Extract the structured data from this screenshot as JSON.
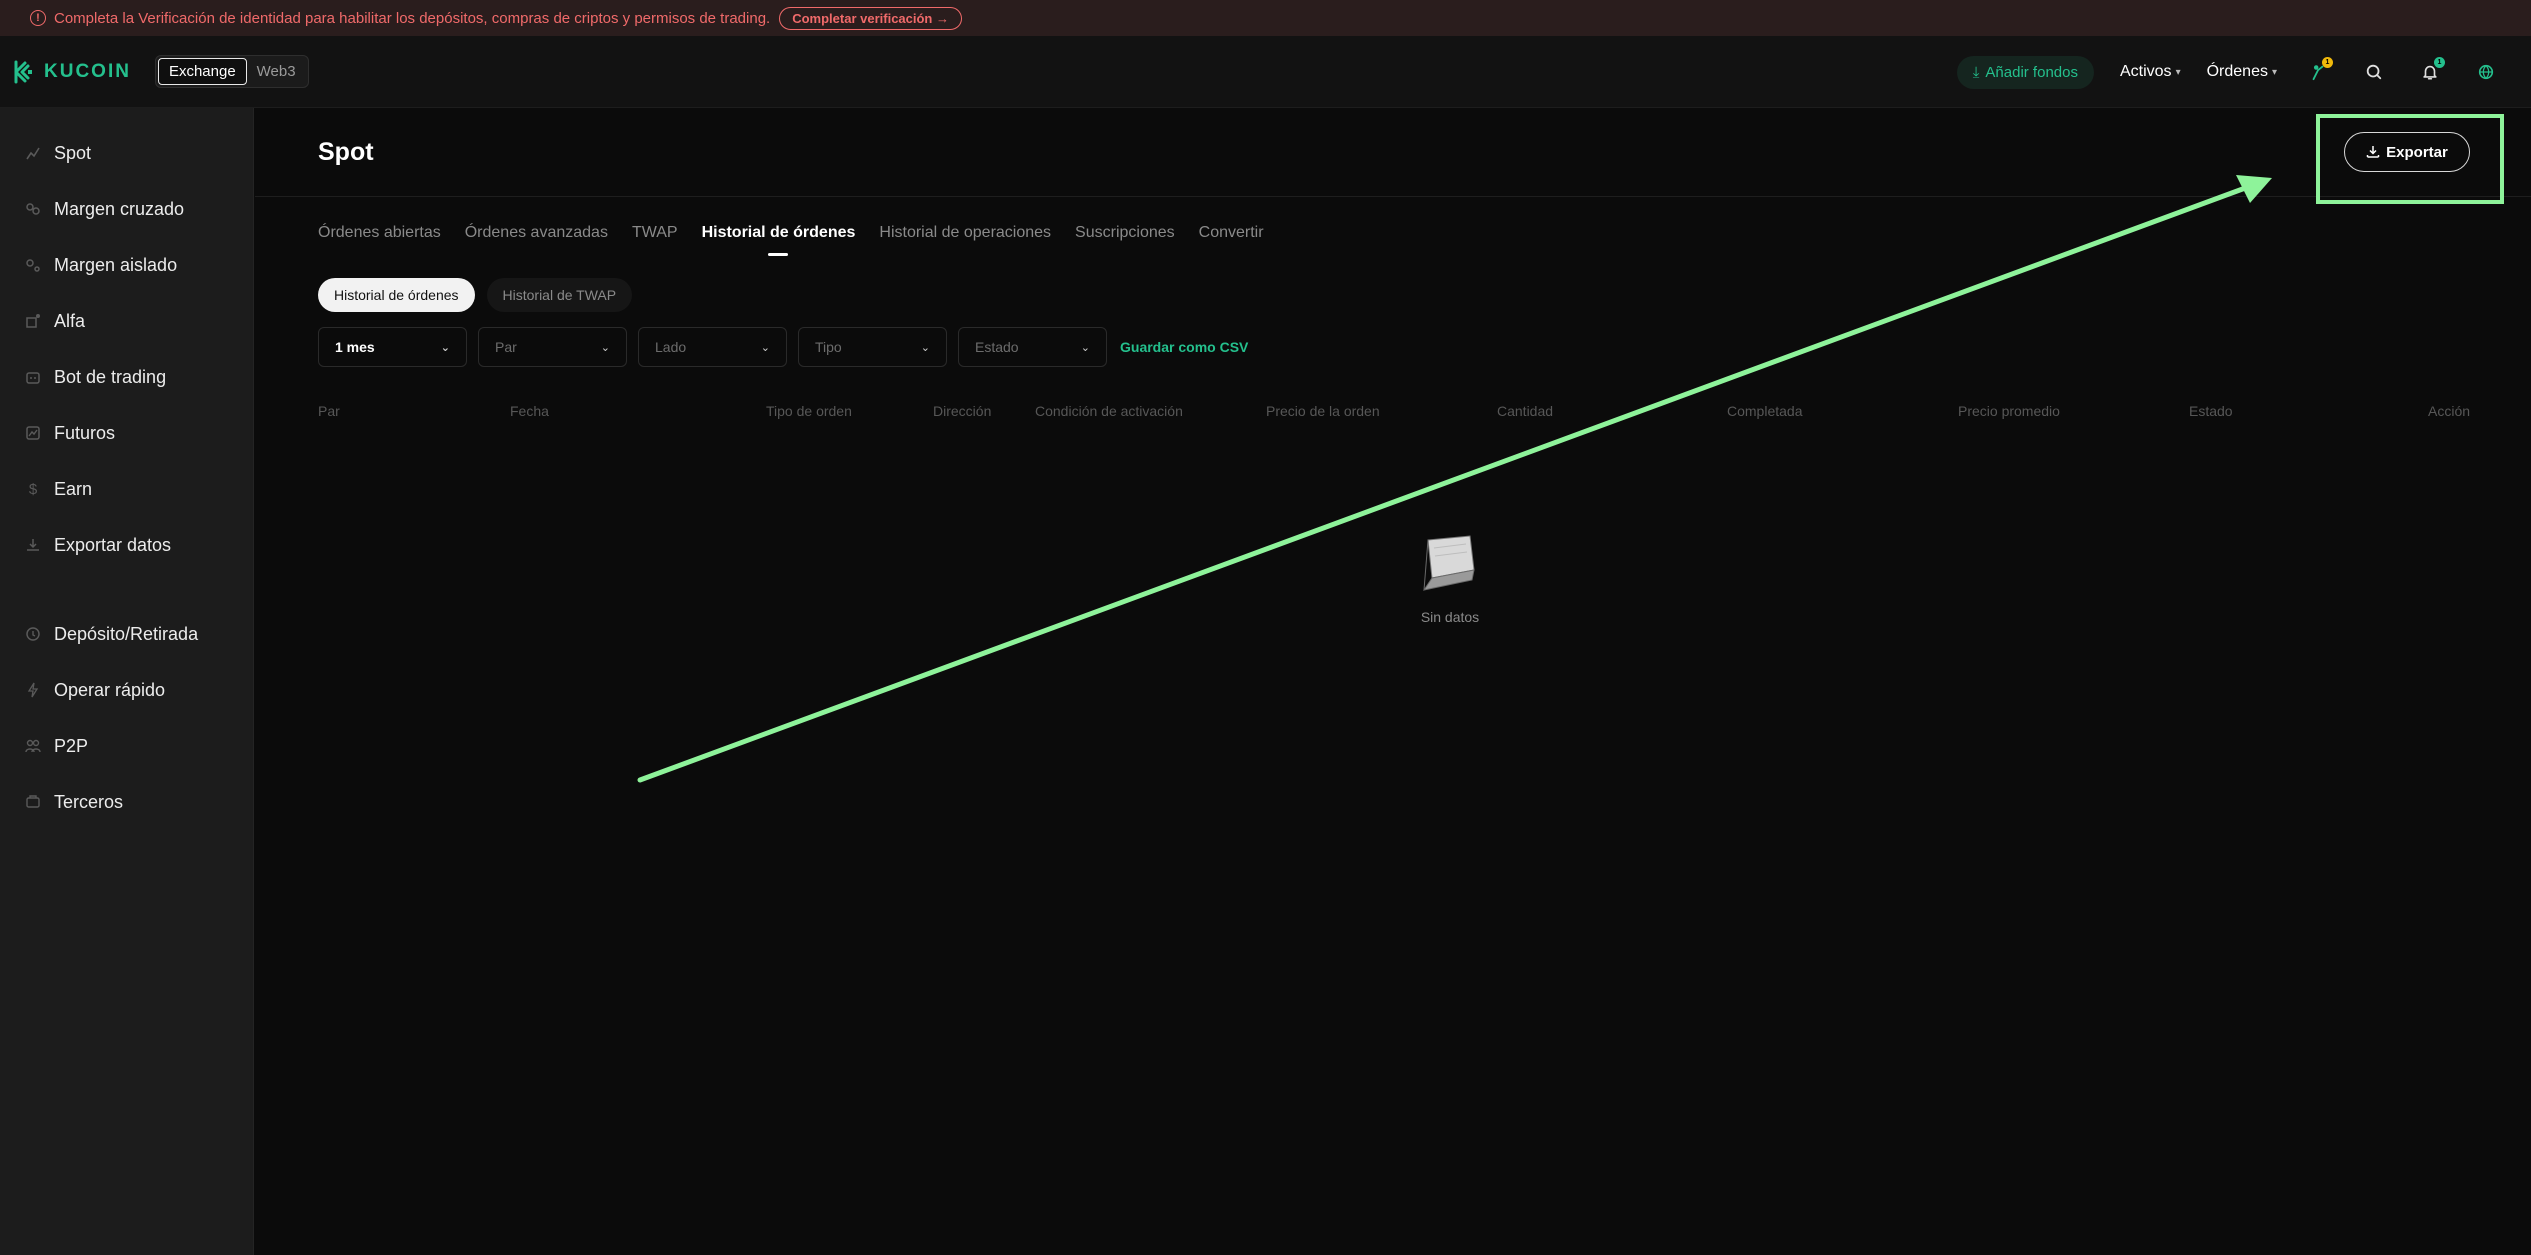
{
  "banner": {
    "message": "Completa la Verificación de identidad para habilitar los depósitos, compras de criptos y permisos de trading.",
    "cta": "Completar verificación →"
  },
  "topnav": {
    "logo": "KUCOIN",
    "switch": [
      "Exchange",
      "Web3"
    ],
    "add_funds": "Añadir fondos",
    "menus": [
      "Activos",
      "Órdenes"
    ],
    "badges": {
      "rewards": "1",
      "notifications": "1"
    }
  },
  "sidebar": {
    "items": [
      {
        "label": "Spot",
        "icon": "spot-icon"
      },
      {
        "label": "Margen cruzado",
        "icon": "cross-margin-icon"
      },
      {
        "label": "Margen aislado",
        "icon": "isolated-margin-icon"
      },
      {
        "label": "Alfa",
        "icon": "alpha-icon"
      },
      {
        "label": "Bot de trading",
        "icon": "bot-icon"
      },
      {
        "label": "Futuros",
        "icon": "futures-icon"
      },
      {
        "label": "Earn",
        "icon": "earn-icon"
      },
      {
        "label": "Exportar datos",
        "icon": "download-icon"
      },
      {
        "label": "Depósito/Retirada",
        "icon": "deposit-icon"
      },
      {
        "label": "Operar rápido",
        "icon": "lightning-icon"
      },
      {
        "label": "P2P",
        "icon": "p2p-icon"
      },
      {
        "label": "Terceros",
        "icon": "third-party-icon"
      }
    ]
  },
  "main": {
    "title": "Spot",
    "export_label": "Exportar",
    "tabs": [
      "Órdenes abiertas",
      "Órdenes avanzadas",
      "TWAP",
      "Historial de órdenes",
      "Historial de operaciones",
      "Suscripciones",
      "Convertir"
    ],
    "active_tab": "Historial de órdenes",
    "subtabs": [
      "Historial de órdenes",
      "Historial de TWAP"
    ],
    "filters": [
      "1 mes",
      "Par",
      "Lado",
      "Tipo",
      "Estado"
    ],
    "csv_link": "Guardar como CSV",
    "columns": [
      "Par",
      "Fecha",
      "Tipo de orden",
      "Dirección",
      "Condición de activación",
      "Precio de la orden",
      "Cantidad",
      "Completada",
      "Precio promedio",
      "Estado",
      "Acción"
    ],
    "empty_text": "Sin datos"
  },
  "colors": {
    "accent": "#24c08d",
    "warning": "#f06a6a",
    "annotation": "#8ef39a"
  }
}
